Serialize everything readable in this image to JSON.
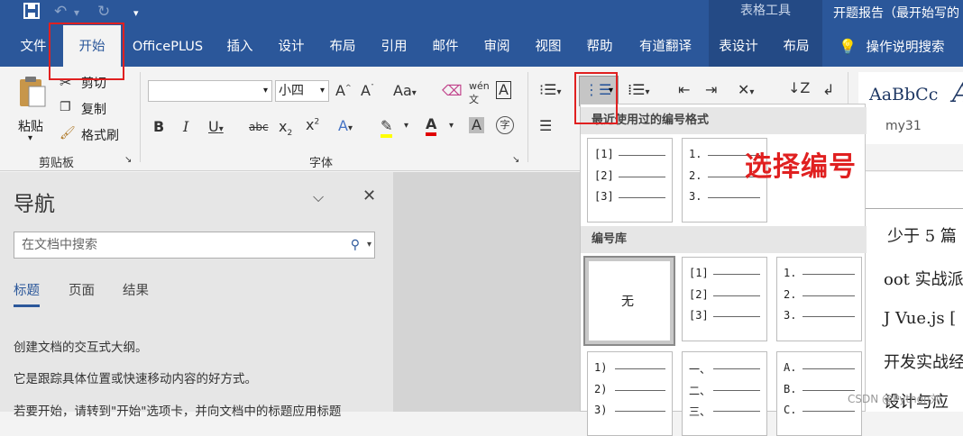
{
  "title_bar": {
    "context_tab_group": "表格工具",
    "document_title": "开题报告（最开始写的"
  },
  "tabs": [
    "文件",
    "开始",
    "OfficePLUS",
    "插入",
    "设计",
    "布局",
    "引用",
    "邮件",
    "审阅",
    "视图",
    "帮助",
    "有道翻译",
    "表设计",
    "布局"
  ],
  "tell_me": "操作说明搜索",
  "clipboard": {
    "paste": "粘贴",
    "cut": "剪切",
    "copy": "复制",
    "format_painter": "格式刷",
    "group_label": "剪贴板"
  },
  "font": {
    "font_name": "",
    "font_size": "小四",
    "group_label": "字体"
  },
  "styles": {
    "preview": "AaBbCc",
    "style_name": "my31"
  },
  "navigation": {
    "title": "导航",
    "search_placeholder": "在文档中搜索",
    "tabs": [
      "标题",
      "页面",
      "结果"
    ],
    "text1": "创建文档的交互式大纲。",
    "text2": "它是跟踪具体位置或快速移动内容的好方式。",
    "text3": "若要开始，请转到\"开始\"选项卡，并向文档中的标题应用标题"
  },
  "numbering_menu": {
    "recent_header": "最近使用过的编号格式",
    "library_header": "编号库",
    "none_label": "无",
    "recent": [
      [
        "[1]",
        "[2]",
        "[3]"
      ],
      [
        "1.",
        "2.",
        "3."
      ]
    ],
    "library": [
      [
        "[1]",
        "[2]",
        "[3]"
      ],
      [
        "1.",
        "2.",
        "3."
      ],
      [
        "1)",
        "2)",
        "3)"
      ],
      [
        "一、",
        "二、",
        "三、"
      ],
      [
        "A.",
        "B.",
        "C."
      ]
    ]
  },
  "document_fragments": [
    "少于 5 篇",
    "oot 实战派",
    "J Vue.js [",
    "开发实战经",
    "设计与应"
  ],
  "annotation": "选择编号",
  "watermark": "CSDN @Python刘"
}
